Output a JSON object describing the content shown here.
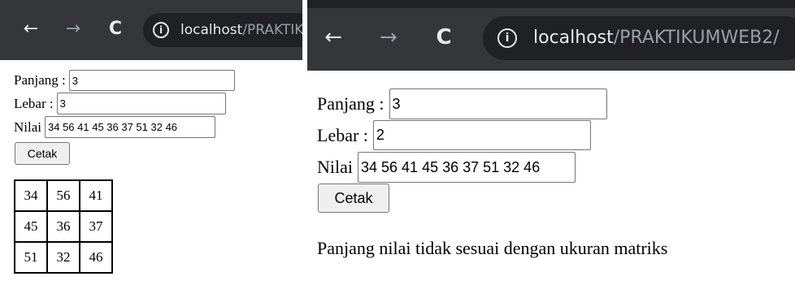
{
  "left": {
    "browser": {
      "back_icon": "←",
      "forward_icon": "→",
      "reload_icon": "C",
      "info_icon": "i",
      "url_host": "localhost",
      "url_path": "/PRAKTIK"
    },
    "form": {
      "panjang_label": "Panjang :",
      "panjang_value": "3",
      "lebar_label": "Lebar :",
      "lebar_value": "3",
      "nilai_label": "Nilai",
      "nilai_value": "34 56 41 45 36 37 51 32 46",
      "cetak_label": "Cetak"
    },
    "matrix": [
      [
        "34",
        "56",
        "41"
      ],
      [
        "45",
        "36",
        "37"
      ],
      [
        "51",
        "32",
        "46"
      ]
    ]
  },
  "right": {
    "browser": {
      "back_icon": "←",
      "forward_icon": "→",
      "reload_icon": "C",
      "info_icon": "i",
      "url_host": "localhost",
      "url_path": "/PRAKTIKUMWEB2/"
    },
    "form": {
      "panjang_label": "Panjang :",
      "panjang_value": "3",
      "lebar_label": "Lebar :",
      "lebar_value": "2",
      "nilai_label": "Nilai",
      "nilai_value": "34 56 41 45 36 37 51 32 46",
      "cetak_label": "Cetak"
    },
    "message": "Panjang nilai tidak sesuai dengan ukuran matriks"
  },
  "colors": {
    "toolbar": "#35363a",
    "omnibox": "#202124",
    "icon": "#e8eaed",
    "icon_disabled": "#9aa0a6"
  }
}
